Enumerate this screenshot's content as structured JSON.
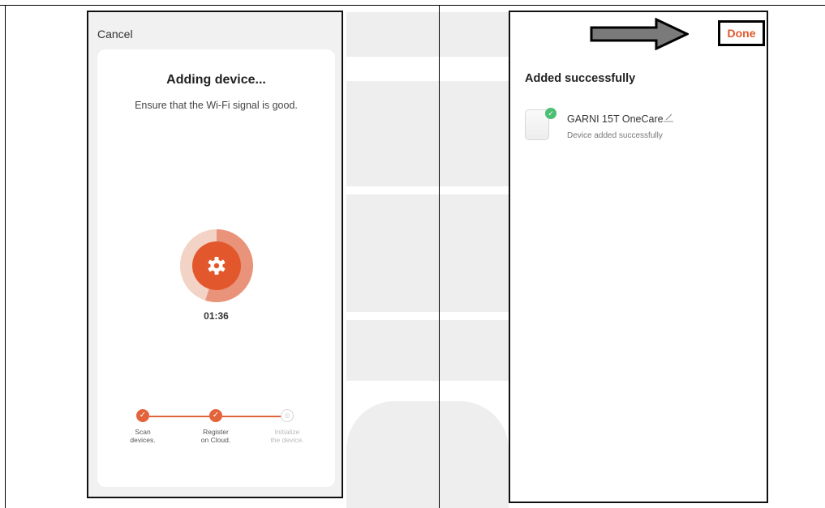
{
  "left_screen": {
    "cancel_label": "Cancel",
    "title": "Adding device...",
    "subtitle": "Ensure that the Wi-Fi signal is good.",
    "timer": "01:36",
    "progress_fraction": 0.55,
    "accent_color": "#e3633a",
    "steps": [
      {
        "label_line1": "Scan",
        "label_line2": "devices.",
        "done": true
      },
      {
        "label_line1": "Register",
        "label_line2": "on Cloud.",
        "done": true
      },
      {
        "label_line1": "Initialize",
        "label_line2": "the device.",
        "done": false
      }
    ]
  },
  "right_screen": {
    "done_label": "Done",
    "title": "Added successfully",
    "device": {
      "name": "GARNI 15T OneCare",
      "status": "Device added successfully",
      "icon": "check-circle-icon"
    }
  }
}
